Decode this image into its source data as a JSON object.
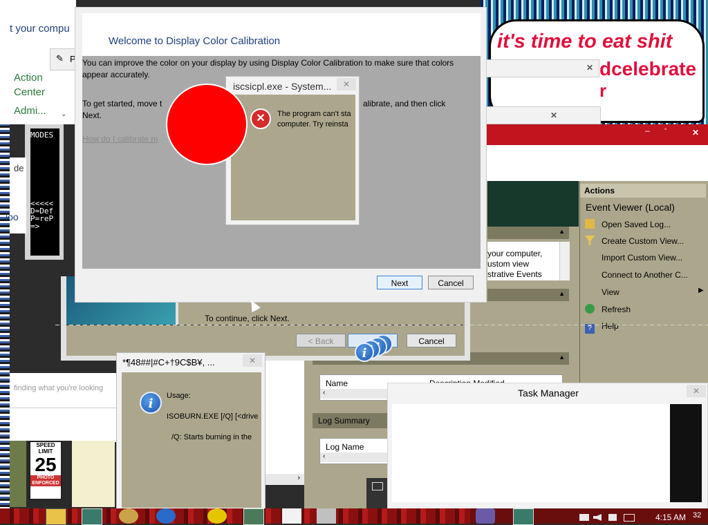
{
  "top_left_panel": {
    "partial_text": "t your compu",
    "action_center": "Action\nCenter",
    "admin": "Admi...",
    "small_button": "P"
  },
  "console": {
    "lines": [
      "MODES",
      "",
      "",
      "",
      "",
      "",
      "",
      "",
      "",
      "<<<<<",
      "D=Def",
      "P=reP",
      "=>"
    ]
  },
  "left_fragments": {
    "de": "de",
    "hoo": "ioo",
    "finding": "finding what you're looking",
    "devi": "devi"
  },
  "calibration": {
    "title": "Welcome to Display Color Calibration",
    "para1": "You can improve the color on your display by using Display Color Calibration to make sure that colors appear accurately.",
    "para2_start": "To get started, move t",
    "para2_end": "alibrate, and then click",
    "para2_next": "Next.",
    "link": "How do I calibrate m",
    "next_button": "Next",
    "cancel_button": "Cancel"
  },
  "error_dialog": {
    "title": "iscsicpl.exe - System...",
    "message_line1": "The program can't sta",
    "message_line2": "computer. Try reinsta"
  },
  "wizard_behind": {
    "continue_text": "To continue, click Next.",
    "back_button": "< Back",
    "cancel_button": "Cancel"
  },
  "meme": {
    "line1": "it's time to eat shit",
    "line2": "dcelebrate",
    "line3": "r"
  },
  "event_viewer": {
    "actions_header": "Actions",
    "root": "Event Viewer (Local)",
    "items": [
      "Open Saved Log...",
      "Create Custom View...",
      "Import Custom View...",
      "Connect to Another C...",
      "View",
      "Refresh",
      "Help"
    ],
    "overview_lines": [
      "your computer,",
      "ustom view",
      "strative Events"
    ],
    "name_column": "Name",
    "desc_columns": "Description   Modified",
    "log_summary": "Log Summary",
    "log_name": "Log Name"
  },
  "isoburn_dialog": {
    "title": "*¶48##|#C+†9C$B¥,  ...",
    "usage": "Usage:",
    "line1": "ISOBURN.EXE [/Q] [<drive",
    "line2": "/Q: Starts burning in the"
  },
  "task_manager": {
    "title": "Task Manager"
  },
  "speed_sign": {
    "line1": "SPEED",
    "line2": "LIMIT",
    "value": "25",
    "line3": "PHOTO",
    "line4": "ENFORCED"
  },
  "taskbar": {
    "time": "4:15 AM",
    "partial": "32"
  },
  "colors": {
    "red_circle": "#ff0000",
    "error_red": "#d62a2a",
    "khaki": "#aca78c",
    "taskbar_red": "#7a0f0f",
    "title_blue": "#1e3f7a"
  }
}
